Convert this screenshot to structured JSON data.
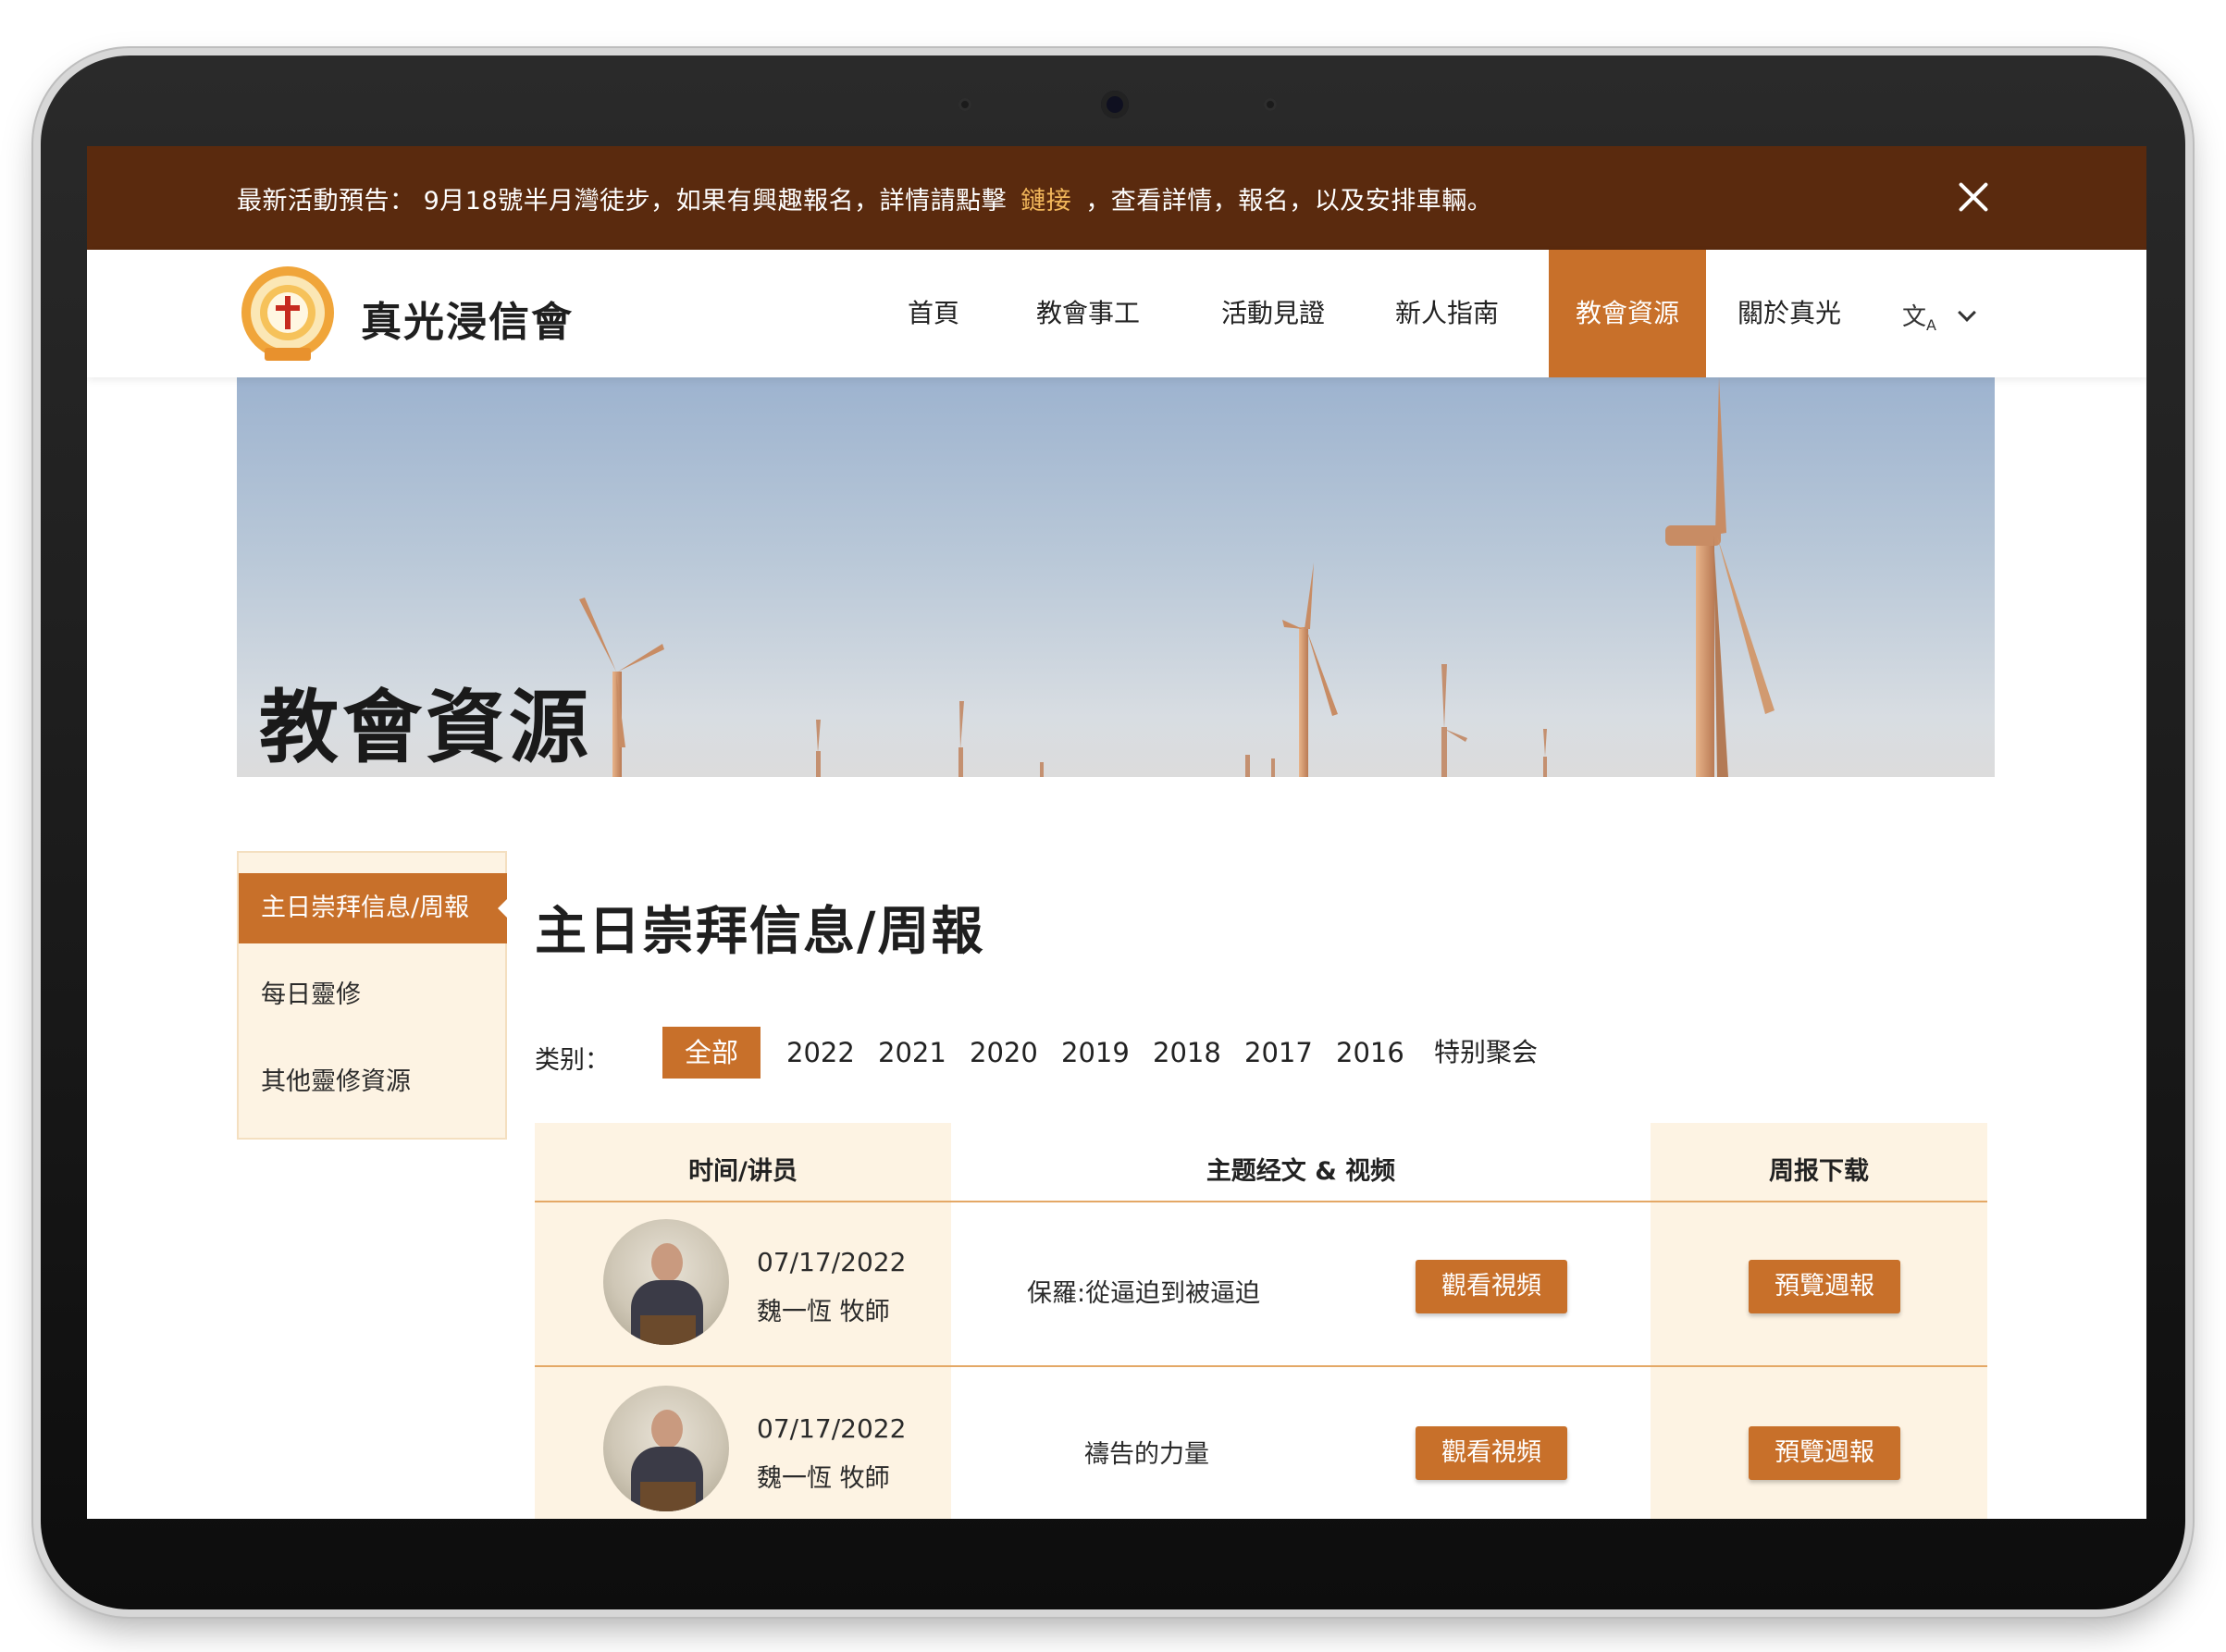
{
  "announcement": {
    "text_before": "最新活動預告： 9月18號半月灣徒步，如果有興趣報名，詳情請點擊",
    "link_text": "鏈接",
    "text_after": "，查看詳情，報名，以及安排車輛。",
    "link_color": "#f2b75b",
    "close_icon": "close-icon"
  },
  "header": {
    "brand": "真光浸信會",
    "nav": [
      "首頁",
      "教會事工",
      "活動見證",
      "新人指南",
      "教會資源",
      "關於真光"
    ],
    "active_nav": "教會資源",
    "language_icon": "translate-icon"
  },
  "hero": {
    "title": "教會資源"
  },
  "sidebar": {
    "items": [
      "主日崇拜信息/周報",
      "每日靈修",
      "其他靈修資源"
    ],
    "active": "主日崇拜信息/周報"
  },
  "main": {
    "title": "主日崇拜信息/周報",
    "filter_label": "类别：",
    "filters": [
      "全部",
      "2022",
      "2021",
      "2020",
      "2019",
      "2018",
      "2017",
      "2016",
      "特别聚会"
    ],
    "active_filter": "全部"
  },
  "table": {
    "headers": [
      "时间/讲员",
      "主题经文 & 视频",
      "周报下载"
    ],
    "rows": [
      {
        "date": "07/17/2022",
        "speaker": "魏一恆 牧師",
        "sermon": "保羅:從逼迫到被逼迫",
        "video_label": "觀看視頻",
        "bulletin_label": "預覽週報"
      },
      {
        "date": "07/17/2022",
        "speaker": "魏一恆 牧師",
        "sermon": "禱告的力量",
        "video_label": "觀看視頻",
        "bulletin_label": "預覽週報"
      }
    ]
  },
  "colors": {
    "announcement_bg": "#5a2a0e",
    "accent": "#c8702a",
    "table_bg": "#fdf3e3"
  }
}
